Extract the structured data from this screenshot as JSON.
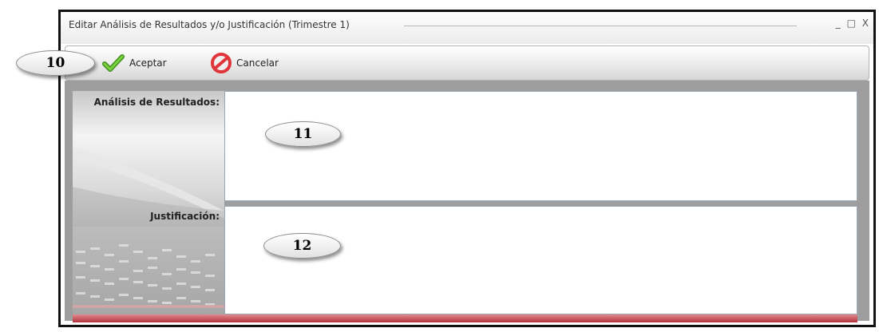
{
  "window": {
    "title": "Editar Análisis de Resultados y/o Justificación (Trimestre 1)",
    "controls": {
      "minimize": "_",
      "maximize": "□",
      "close": "X"
    }
  },
  "toolbar": {
    "accept_label": "Aceptar",
    "cancel_label": "Cancelar",
    "accept_icon": "check-icon",
    "cancel_icon": "cancel-icon"
  },
  "form": {
    "analysis_label": "Análisis de Resultados:",
    "analysis_value": "",
    "justification_label": "Justificación:",
    "justification_value": ""
  },
  "callouts": {
    "toolbar": "10",
    "analysis": "11",
    "justification": "12"
  },
  "colors": {
    "accept_green": "#5cb82a",
    "cancel_red": "#e0353a",
    "footer_red": "#b4323c"
  }
}
